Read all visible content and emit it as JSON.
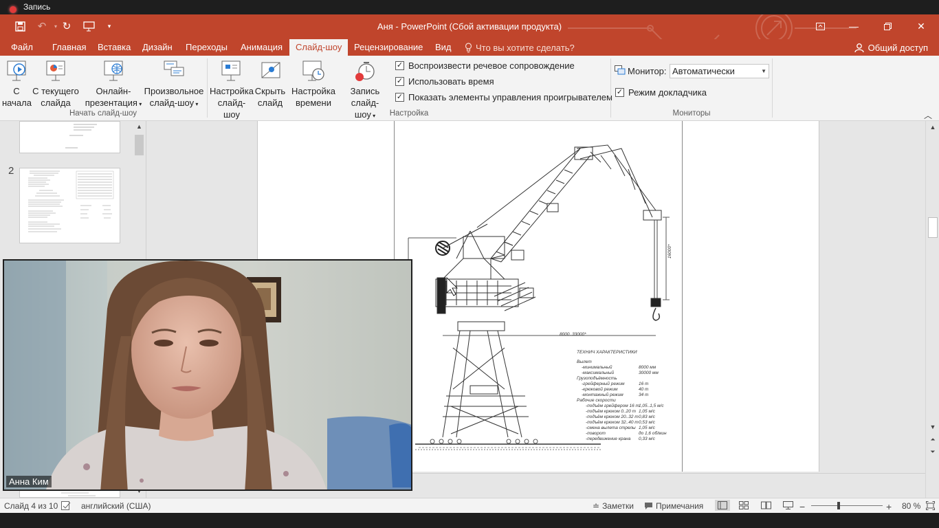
{
  "recording": {
    "label": "Запись"
  },
  "window": {
    "title": "Аня - PowerPoint (Сбой активации продукта)"
  },
  "tabs": [
    {
      "label": "Файл"
    },
    {
      "label": "Главная"
    },
    {
      "label": "Вставка"
    },
    {
      "label": "Дизайн"
    },
    {
      "label": "Переходы"
    },
    {
      "label": "Анимация"
    },
    {
      "label": "Слайд-шоу"
    },
    {
      "label": "Рецензирование"
    },
    {
      "label": "Вид"
    }
  ],
  "tell_me": "Что вы хотите сделать?",
  "share": "Общий доступ",
  "ribbon": {
    "start": {
      "from_beginning": [
        "С",
        "начала"
      ],
      "from_current": [
        "С текущего",
        "слайда"
      ],
      "online": [
        "Онлайн-",
        "презентация"
      ],
      "custom": [
        "Произвольное",
        "слайд-шоу"
      ],
      "group": "Начать слайд-шоу"
    },
    "setup": {
      "setup_show": [
        "Настройка",
        "слайд-шоу"
      ],
      "hide_slide": [
        "Скрыть",
        "слайд"
      ],
      "rehearse": [
        "Настройка",
        "времени"
      ],
      "record": [
        "Запись слайд-",
        "шоу"
      ],
      "play_narrations": "Воспроизвести речевое сопровождение",
      "use_timings": "Использовать время",
      "show_media_controls": "Показать элементы управления проигрывателем",
      "group": "Настройка"
    },
    "monitors": {
      "monitor_label": "Монитор:",
      "monitor_value": "Автоматически",
      "presenter_view": "Режим докладчика",
      "group": "Мониторы"
    }
  },
  "thumbnails": [
    {
      "number": "2"
    }
  ],
  "drawing": {
    "title": "ТЕХНИЧ ХАРАКТЕРИСТИКИ",
    "dim_1": "8000..33000*",
    "dim_2": "16000*",
    "specs": [
      {
        "label": "Вылет",
        "value": ""
      },
      {
        "label": "-минимальный",
        "value": "8000 мм"
      },
      {
        "label": "-максимальный",
        "value": "30000 мм"
      },
      {
        "label": "Грузоподъёмность",
        "value": ""
      },
      {
        "label": "-грейферный режим",
        "value": "16 т"
      },
      {
        "label": "-крюковой режим",
        "value": "40 т"
      },
      {
        "label": "-монтажный режим",
        "value": "34 т"
      },
      {
        "label": "Рабочие скорости",
        "value": ""
      },
      {
        "label": "-подъём грейфером 16 т",
        "value": "1,05..1,5 м/с"
      },
      {
        "label": "-подъём крюком 0..20 т",
        "value": "1,05 м/с"
      },
      {
        "label": "-подъём крюком 20..32 т",
        "value": "0,83 м/с"
      },
      {
        "label": "-подъём крюком 32..40 т",
        "value": "0,53 м/с"
      },
      {
        "label": "-смена вылета стрелы",
        "value": "1,05 м/с"
      },
      {
        "label": "-поворот",
        "value": "до 1,6 об/мин"
      },
      {
        "label": "-передвижение крана",
        "value": "0,33 м/с"
      }
    ]
  },
  "webcam": {
    "name": "Анна Ким"
  },
  "status": {
    "slide": "Слайд 4 из 10",
    "language": "английский (США)",
    "notes": "Заметки",
    "comments": "Примечания",
    "zoom": "80 %",
    "zoom_level_percent": 80
  },
  "colors": {
    "accent": "#c0452c",
    "ribbon_bg": "#f3f3f3",
    "workspace_bg": "#e6e6e6"
  }
}
